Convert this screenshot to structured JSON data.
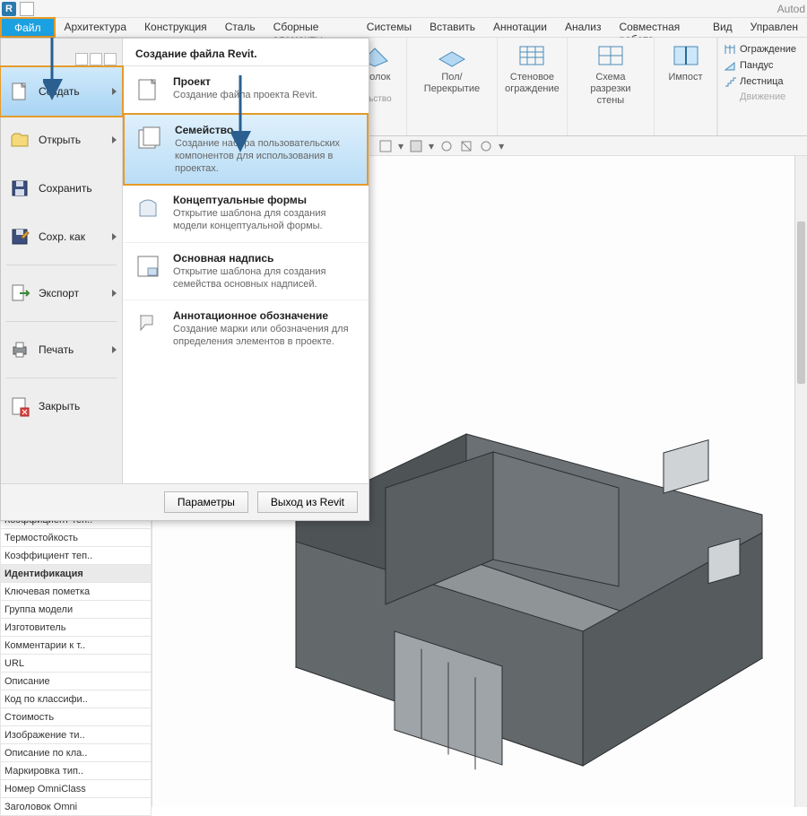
{
  "app_title_partial": "Autod",
  "ribbon_tabs": [
    "Архитектура",
    "Конструкция",
    "Сталь",
    "Сборные элементы",
    "Системы",
    "Вставить",
    "Аннотации",
    "Анализ",
    "Совместная работа",
    "Вид",
    "Управлен"
  ],
  "file_tab_label": "Файл",
  "ribbon_groups": {
    "ceiling": "отолок",
    "floor": "Пол/Перекрытие",
    "wall_enclosure_line1": "Стеновое",
    "wall_enclosure_line2": "ограждение",
    "section_line1": "Схема разрезки",
    "section_line2": "стены",
    "mullion": "Импост",
    "below_cut": "ельство"
  },
  "side_items": [
    "Ограждение",
    "Пандус",
    "Лестница",
    "Движение"
  ],
  "file_menu": {
    "header": "Создание файла Revit.",
    "left": {
      "create": "Создать",
      "open": "Открыть",
      "save": "Сохранить",
      "save_as": "Сохр. как",
      "export": "Экспорт",
      "print": "Печать",
      "close": "Закрыть"
    },
    "items": {
      "project_title": "Проект",
      "project_desc": "Создание файла проекта Revit.",
      "family_title": "Семейство",
      "family_desc": "Создание набора пользовательских компонентов для использования в проектах.",
      "concept_title": "Концептуальные формы",
      "concept_desc": "Открытие шаблона для создания модели концептуальной формы.",
      "titleblock_title": "Основная надпись",
      "titleblock_desc": "Открытие шаблона для создания семейства основных надписей.",
      "anno_title": "Аннотационное обозначение",
      "anno_desc": "Создание марки или обозначения для определения элементов в проекте."
    },
    "btn_options": "Параметры",
    "btn_exit": "Выход из Revit"
  },
  "properties": {
    "rows": [
      "Коэффициент теп..",
      "Термостойкость",
      "Коэффициент теп.."
    ],
    "section": "Идентификация",
    "rows2": [
      "Ключевая пометка",
      "Группа модели",
      "Изготовитель",
      "Комментарии к т..",
      "URL",
      "Описание",
      "Код по классифи..",
      "Стоимость",
      "Изображение ти..",
      "Описание по кла..",
      "Маркировка тип..",
      "Номер OmniClass",
      "Заголовок Omni"
    ]
  }
}
